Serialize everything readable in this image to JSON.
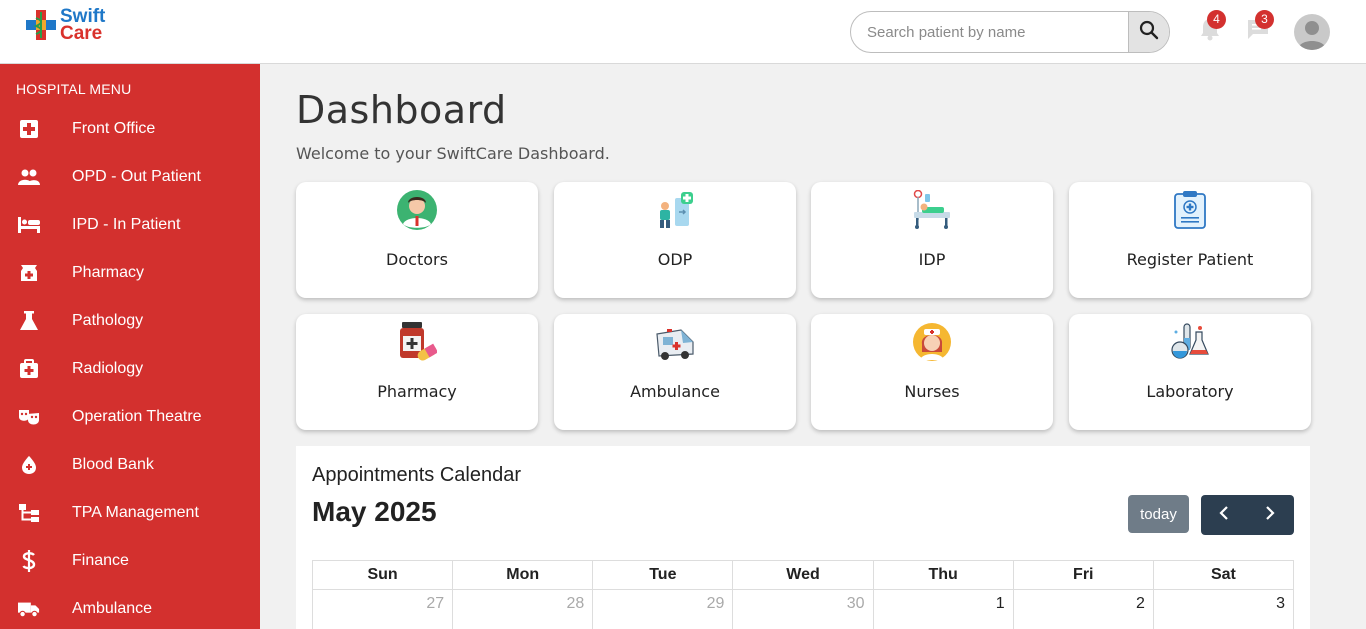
{
  "header": {
    "logo_line1": "Swift",
    "logo_line2": "Care",
    "search_placeholder": "Search patient by name",
    "notifications_count": "4",
    "messages_count": "3"
  },
  "sidebar": {
    "title": "HOSPITAL MENU",
    "items": [
      {
        "label": "Front Office",
        "icon": "medical-cross-icon"
      },
      {
        "label": "OPD - Out Patient",
        "icon": "people-icon"
      },
      {
        "label": "IPD - In Patient",
        "icon": "bed-icon"
      },
      {
        "label": "Pharmacy",
        "icon": "pharmacy-icon"
      },
      {
        "label": "Pathology",
        "icon": "flask-icon"
      },
      {
        "label": "Radiology",
        "icon": "medical-kit-icon"
      },
      {
        "label": "Operation Theatre",
        "icon": "masks-icon"
      },
      {
        "label": "Blood Bank",
        "icon": "blood-drop-icon"
      },
      {
        "label": "TPA Management",
        "icon": "hierarchy-icon"
      },
      {
        "label": "Finance",
        "icon": "dollar-icon"
      },
      {
        "label": "Ambulance",
        "icon": "truck-icon"
      }
    ]
  },
  "main": {
    "title": "Dashboard",
    "subtitle": "Welcome to your SwiftCare Dashboard.",
    "cards": [
      {
        "label": "Doctors",
        "icon": "doctor-icon"
      },
      {
        "label": "ODP",
        "icon": "outpatient-icon"
      },
      {
        "label": "IDP",
        "icon": "hospital-bed-icon"
      },
      {
        "label": "Register Patient",
        "icon": "clipboard-icon"
      },
      {
        "label": "Pharmacy",
        "icon": "medicine-bottle-icon"
      },
      {
        "label": "Ambulance",
        "icon": "ambulance-icon"
      },
      {
        "label": "Nurses",
        "icon": "nurse-icon"
      },
      {
        "label": "Laboratory",
        "icon": "lab-icon"
      }
    ]
  },
  "calendar": {
    "heading": "Appointments Calendar",
    "month_title": "May 2025",
    "today_label": "today",
    "days": [
      "Sun",
      "Mon",
      "Tue",
      "Wed",
      "Thu",
      "Fri",
      "Sat"
    ],
    "first_week": [
      "27",
      "28",
      "29",
      "30",
      "1",
      "2",
      "3"
    ]
  },
  "colors": {
    "sidebar_bg": "#d3302e",
    "badge": "#d3312f",
    "nav_button": "#2c3e50",
    "today_button": "#6f7c88"
  }
}
